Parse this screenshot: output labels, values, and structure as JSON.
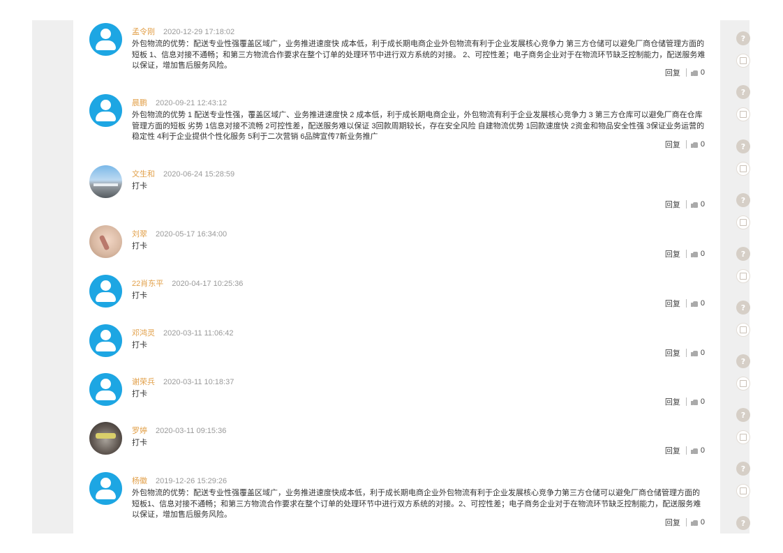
{
  "comments": [
    {
      "name": "孟令刚",
      "time": "2020-12-29 17:18:02",
      "content": "外包物流的优势：配送专业性强覆盖区域广，业务推进速度快 成本低，利于成长期电商企业外包物流有利于企业发展核心竞争力 第三方仓储可以避免厂商仓储管理方面的短板 1、信息对接不通畅；和第三方物流合作要求在整个订单的处理环节中进行双方系统的对接。 2、可控性差；电子商务企业对于在物流环节缺乏控制能力，配送服务难以保证，增加售后服务风险。",
      "reply": "回复",
      "likes": "0",
      "avatar": "default-avatar"
    },
    {
      "name": "晨鹏",
      "time": "2020-09-21 12:43:12",
      "content": "外包物流的优势 1 配送专业性强，覆盖区域广、业务推进速度快 2 成本低，利于成长期电商企业，外包物流有利于企业发展核心竞争力 3 第三方仓库可以避免厂商在仓库管理方面的短板 劣势 1信息对接不流畅 2可控性差，配送服务难以保证 3回款周期较长，存在安全风险 自建物流优势 1回款速度快 2资金和物品安全性强 3保证业务运营的稳定性 4利于企业提供个性化服务 5利于二次营销 6品牌宣传7新业务推广",
      "reply": "回复",
      "likes": "0",
      "avatar": "default-avatar"
    },
    {
      "name": "文生和",
      "time": "2020-06-24 15:28:59",
      "content": "打卡",
      "reply": "回复",
      "likes": "0",
      "avatar": "photo-road"
    },
    {
      "name": "刘翠",
      "time": "2020-05-17 16:34:00",
      "content": "打卡",
      "reply": "回复",
      "likes": "0",
      "avatar": "photo-hand"
    },
    {
      "name": "22肖东平",
      "time": "2020-04-17 10:25:36",
      "content": "打卡",
      "reply": "回复",
      "likes": "0",
      "avatar": "default-avatar"
    },
    {
      "name": "邓鸿灵",
      "time": "2020-03-11 11:06:42",
      "content": "打卡",
      "reply": "回复",
      "likes": "0",
      "avatar": "default-avatar"
    },
    {
      "name": "谢荣兵",
      "time": "2020-03-11 10:18:37",
      "content": "打卡",
      "reply": "回复",
      "likes": "0",
      "avatar": "default-avatar"
    },
    {
      "name": "罗婷",
      "time": "2020-03-11 09:15:36",
      "content": "打卡",
      "reply": "回复",
      "likes": "0",
      "avatar": "photo-person"
    },
    {
      "name": "杨徽",
      "time": "2019-12-26 15:29:26",
      "content": "外包物流的优势：配送专业性强覆盖区域广，业务推进速度快成本低，利于成长期电商企业外包物流有利于企业发展核心竞争力第三方仓储可以避免厂商仓储管理方面的短板1、信息对接不通畅；和第三方物流合作要求在整个订单的处理环节中进行双方系统的对接。2、可控性差；电子商务企业对于在物流环节缺乏控制能力，配送服务难以保证，增加售后服务风险。",
      "reply": "回复",
      "likes": "0",
      "avatar": "default-avatar"
    }
  ],
  "right_rail": [
    "help-icon",
    "print-icon",
    "help-icon",
    "print-icon",
    "help-icon",
    "print-icon",
    "help-icon",
    "print-icon",
    "help-icon",
    "print-icon",
    "help-icon",
    "print-icon",
    "help-icon",
    "print-icon",
    "help-icon",
    "print-icon",
    "help-icon",
    "print-icon",
    "help-icon"
  ],
  "colors": {
    "username": "#e2a04a",
    "avatar_bg": "#1da6e3",
    "gutter": "#efefef"
  }
}
